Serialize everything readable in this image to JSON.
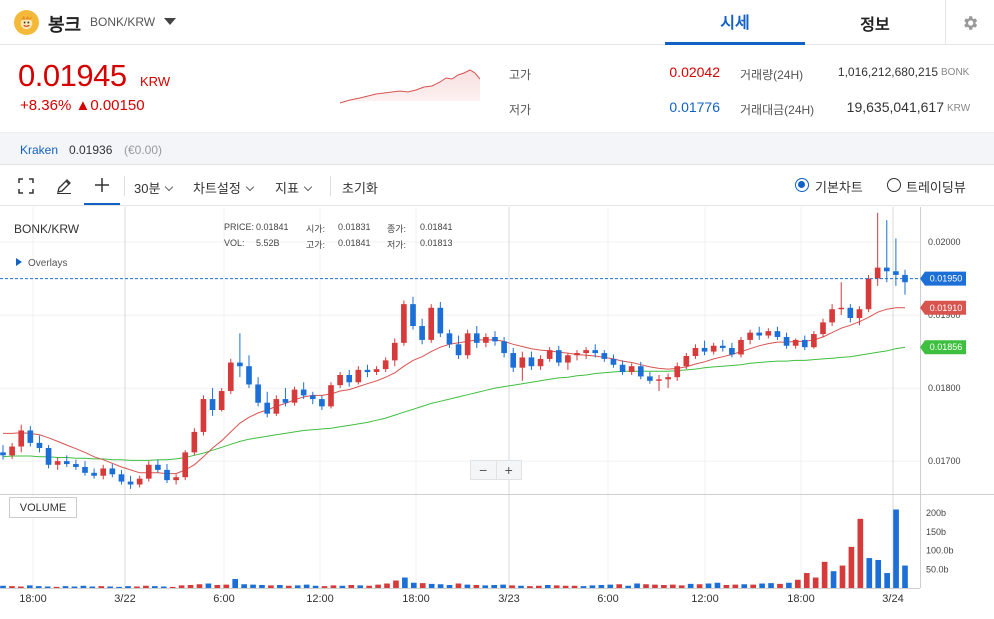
{
  "header": {
    "coin_name": "봉크",
    "pair": "BONK/KRW",
    "tabs": [
      "시세",
      "정보"
    ]
  },
  "price": {
    "current": "0.01945",
    "unit": "KRW",
    "change_pct": "+8.36%",
    "change_amt": "▲0.00150"
  },
  "stats": {
    "high_label": "고가",
    "high_value": "0.02042",
    "low_label": "저가",
    "low_value": "0.01776",
    "volume_label": "거래량(24H)",
    "volume_value": "1,016,212,680,215",
    "volume_unit": "BONK",
    "amount_label": "거래대금(24H)",
    "amount_value": "19,635,041,617",
    "amount_unit": "KRW"
  },
  "exchange": {
    "name": "Kraken",
    "price": "0.01936",
    "diff": "(€0.00)"
  },
  "toolbar": {
    "interval": "30분",
    "chart_settings": "차트설정",
    "indicators": "지표",
    "reset": "초기화",
    "basic_chart": "기본차트",
    "tradingview": "트레이딩뷰"
  },
  "chart_legend": {
    "pair": "BONK/KRW",
    "overlays": "Overlays",
    "price_label": "PRICE:",
    "price_value": "0.01841",
    "open_label": "시가:",
    "open_value": "0.01831",
    "change_label": "종가:",
    "change_value": "0.01841",
    "vol_label": "VOL:",
    "vol_value": "5.52B",
    "high_label": "고가:",
    "high_value": "0.01841",
    "low_label": "저가:",
    "low_value": "0.01813",
    "volume_pane": "VOLUME"
  },
  "colors": {
    "up": "#d63a3a",
    "down": "#1b6fd6",
    "ma_short": "#d9534f",
    "ma_long": "#3fbf3f",
    "accent": "#1261c4"
  },
  "chart_data": {
    "type": "candlestick",
    "title": "BONK/KRW",
    "price_axis_ticks": [
      "0.02000",
      "0.01900",
      "0.01800",
      "0.01700"
    ],
    "price_axis_tick_values": [
      0.02,
      0.019,
      0.018,
      0.017
    ],
    "volume_axis_ticks": [
      "200b",
      "150b",
      "100.0b",
      "50.0b"
    ],
    "volume_axis_tick_values": [
      200,
      150,
      100,
      50
    ],
    "time_axis_ticks": [
      "18:00",
      "3/22",
      "6:00",
      "12:00",
      "18:00",
      "3/23",
      "6:00",
      "12:00",
      "18:00",
      "3/24"
    ],
    "ylim": [
      0.01655,
      0.02048
    ],
    "vol_ylim": [
      0,
      230
    ],
    "current_price_label": "0.01950",
    "current_price": 0.0195,
    "ma_short_label": "0.01910",
    "ma_short_last": 0.0191,
    "ma_long_label": "0.01856",
    "ma_long_last": 0.01856,
    "candles": [
      [
        0.01712,
        0.01722,
        0.01702,
        0.01708
      ],
      [
        0.01708,
        0.01725,
        0.01703,
        0.0172
      ],
      [
        0.0172,
        0.0175,
        0.01712,
        0.01742
      ],
      [
        0.01742,
        0.01748,
        0.0172,
        0.01725
      ],
      [
        0.01725,
        0.01735,
        0.01712,
        0.01718
      ],
      [
        0.01718,
        0.01722,
        0.0169,
        0.01695
      ],
      [
        0.01695,
        0.01705,
        0.01688,
        0.017
      ],
      [
        0.017,
        0.01708,
        0.01692,
        0.01696
      ],
      [
        0.01696,
        0.01702,
        0.01688,
        0.01692
      ],
      [
        0.01692,
        0.017,
        0.0168,
        0.01684
      ],
      [
        0.01684,
        0.0169,
        0.01676,
        0.0168
      ],
      [
        0.0168,
        0.01695,
        0.01675,
        0.0169
      ],
      [
        0.0169,
        0.01696,
        0.01678,
        0.01682
      ],
      [
        0.01682,
        0.01688,
        0.01668,
        0.01672
      ],
      [
        0.01672,
        0.0168,
        0.01662,
        0.01668
      ],
      [
        0.01668,
        0.0168,
        0.01664,
        0.01676
      ],
      [
        0.01676,
        0.017,
        0.01672,
        0.01695
      ],
      [
        0.01695,
        0.01702,
        0.01684,
        0.01688
      ],
      [
        0.01688,
        0.01696,
        0.0167,
        0.01674
      ],
      [
        0.01674,
        0.01682,
        0.01668,
        0.01678
      ],
      [
        0.01678,
        0.01715,
        0.01674,
        0.01712
      ],
      [
        0.01712,
        0.01745,
        0.01708,
        0.0174
      ],
      [
        0.0174,
        0.0179,
        0.01735,
        0.01785
      ],
      [
        0.01785,
        0.018,
        0.01762,
        0.0177
      ],
      [
        0.0177,
        0.018,
        0.01768,
        0.01796
      ],
      [
        0.01796,
        0.0184,
        0.01792,
        0.01835
      ],
      [
        0.01835,
        0.01875,
        0.01815,
        0.0183
      ],
      [
        0.0183,
        0.01845,
        0.018,
        0.01805
      ],
      [
        0.01805,
        0.01815,
        0.01775,
        0.0178
      ],
      [
        0.0178,
        0.01795,
        0.0176,
        0.01765
      ],
      [
        0.01765,
        0.0179,
        0.01762,
        0.01785
      ],
      [
        0.01785,
        0.018,
        0.01775,
        0.0178
      ],
      [
        0.0178,
        0.01802,
        0.01776,
        0.01798
      ],
      [
        0.01798,
        0.01808,
        0.01785,
        0.0179
      ],
      [
        0.0179,
        0.01795,
        0.01778,
        0.01785
      ],
      [
        0.01785,
        0.0179,
        0.0177,
        0.01775
      ],
      [
        0.01775,
        0.01808,
        0.01772,
        0.01804
      ],
      [
        0.01804,
        0.01822,
        0.018,
        0.01818
      ],
      [
        0.01818,
        0.01825,
        0.01802,
        0.01808
      ],
      [
        0.01808,
        0.0183,
        0.01805,
        0.01825
      ],
      [
        0.01825,
        0.01832,
        0.01815,
        0.01822
      ],
      [
        0.01822,
        0.0183,
        0.01818,
        0.01826
      ],
      [
        0.01826,
        0.01842,
        0.01822,
        0.01838
      ],
      [
        0.01838,
        0.01868,
        0.0183,
        0.01862
      ],
      [
        0.01862,
        0.0192,
        0.01858,
        0.01915
      ],
      [
        0.01915,
        0.01925,
        0.0188,
        0.01885
      ],
      [
        0.01885,
        0.01895,
        0.0186,
        0.01866
      ],
      [
        0.01866,
        0.01915,
        0.01862,
        0.0191
      ],
      [
        0.0191,
        0.01918,
        0.0187,
        0.01875
      ],
      [
        0.01875,
        0.0188,
        0.01855,
        0.0186
      ],
      [
        0.0186,
        0.01872,
        0.0184,
        0.01845
      ],
      [
        0.01845,
        0.0188,
        0.0184,
        0.01875
      ],
      [
        0.01875,
        0.01885,
        0.01855,
        0.01862
      ],
      [
        0.01862,
        0.01875,
        0.01856,
        0.0187
      ],
      [
        0.0187,
        0.01878,
        0.01858,
        0.01864
      ],
      [
        0.01864,
        0.0187,
        0.01842,
        0.01848
      ],
      [
        0.01848,
        0.01855,
        0.01822,
        0.01828
      ],
      [
        0.01828,
        0.0185,
        0.0181,
        0.01842
      ],
      [
        0.01842,
        0.0185,
        0.01825,
        0.0183
      ],
      [
        0.0183,
        0.01845,
        0.01825,
        0.0184
      ],
      [
        0.0184,
        0.01856,
        0.01836,
        0.01852
      ],
      [
        0.01852,
        0.01858,
        0.0183,
        0.01835
      ],
      [
        0.01835,
        0.01848,
        0.01825,
        0.01845
      ],
      [
        0.01845,
        0.01852,
        0.01838,
        0.01848
      ],
      [
        0.01848,
        0.01856,
        0.0184,
        0.01852
      ],
      [
        0.01852,
        0.0186,
        0.01842,
        0.01848
      ],
      [
        0.01848,
        0.01852,
        0.01836,
        0.0184
      ],
      [
        0.0184,
        0.01846,
        0.01828,
        0.01832
      ],
      [
        0.01832,
        0.01838,
        0.01818,
        0.01822
      ],
      [
        0.01822,
        0.01834,
        0.01818,
        0.0183
      ],
      [
        0.0183,
        0.01836,
        0.01812,
        0.01816
      ],
      [
        0.01816,
        0.01822,
        0.01806,
        0.0181
      ],
      [
        0.0181,
        0.01818,
        0.01796,
        0.01812
      ],
      [
        0.01812,
        0.0182,
        0.018,
        0.01815
      ],
      [
        0.01815,
        0.01835,
        0.0181,
        0.0183
      ],
      [
        0.0183,
        0.01848,
        0.01826,
        0.01844
      ],
      [
        0.01844,
        0.0186,
        0.0184,
        0.01855
      ],
      [
        0.01855,
        0.01865,
        0.01845,
        0.0185
      ],
      [
        0.0185,
        0.01862,
        0.01846,
        0.01858
      ],
      [
        0.01858,
        0.01866,
        0.0185,
        0.01855
      ],
      [
        0.01855,
        0.01862,
        0.01842,
        0.01846
      ],
      [
        0.01846,
        0.0187,
        0.01842,
        0.01866
      ],
      [
        0.01866,
        0.0188,
        0.0186,
        0.01876
      ],
      [
        0.01876,
        0.01884,
        0.01866,
        0.01872
      ],
      [
        0.01872,
        0.01882,
        0.01868,
        0.01878
      ],
      [
        0.01878,
        0.01884,
        0.01866,
        0.0187
      ],
      [
        0.0187,
        0.01876,
        0.01854,
        0.01858
      ],
      [
        0.01858,
        0.01868,
        0.01854,
        0.01866
      ],
      [
        0.01866,
        0.01872,
        0.01852,
        0.01856
      ],
      [
        0.01856,
        0.01878,
        0.01854,
        0.01874
      ],
      [
        0.01874,
        0.01895,
        0.0187,
        0.0189
      ],
      [
        0.0189,
        0.01915,
        0.01885,
        0.01908
      ],
      [
        0.01908,
        0.01945,
        0.019,
        0.0191
      ],
      [
        0.0191,
        0.01915,
        0.0189,
        0.01896
      ],
      [
        0.01896,
        0.01912,
        0.01886,
        0.01908
      ],
      [
        0.01908,
        0.01955,
        0.01904,
        0.0195
      ],
      [
        0.0195,
        0.0204,
        0.0194,
        0.01965
      ],
      [
        0.01965,
        0.0203,
        0.01945,
        0.0196
      ],
      [
        0.0196,
        0.02005,
        0.0194,
        0.01955
      ],
      [
        0.01955,
        0.01962,
        0.01928,
        0.01945
      ]
    ],
    "volumes": [
      6,
      5,
      4,
      7,
      5,
      4,
      3,
      5,
      4,
      6,
      4,
      5,
      4,
      3,
      5,
      4,
      6,
      5,
      4,
      3,
      7,
      8,
      10,
      12,
      8,
      9,
      24,
      10,
      9,
      8,
      7,
      8,
      6,
      7,
      9,
      6,
      5,
      7,
      6,
      8,
      7,
      6,
      9,
      12,
      20,
      28,
      14,
      13,
      11,
      10,
      8,
      12,
      9,
      8,
      7,
      8,
      9,
      7,
      6,
      5,
      6,
      8,
      7,
      6,
      6,
      5,
      7,
      8,
      9,
      10,
      6,
      12,
      10,
      9,
      8,
      9,
      7,
      11,
      10,
      12,
      14,
      8,
      9,
      10,
      9,
      12,
      13,
      11,
      14,
      22,
      40,
      28,
      70,
      45,
      60,
      110,
      185,
      80,
      75,
      40,
      210,
      60
    ],
    "ma_short": [
      0.01738,
      0.01738,
      0.01739,
      0.01738,
      0.01736,
      0.01732,
      0.01727,
      0.01722,
      0.01717,
      0.01712,
      0.01706,
      0.01702,
      0.01697,
      0.01692,
      0.01688,
      0.01684,
      0.01684,
      0.01684,
      0.01683,
      0.01683,
      0.01688,
      0.01695,
      0.01706,
      0.01718,
      0.01728,
      0.0174,
      0.01752,
      0.0176,
      0.01766,
      0.0177,
      0.01775,
      0.01779,
      0.01784,
      0.01788,
      0.0179,
      0.0179,
      0.01792,
      0.01796,
      0.01798,
      0.01802,
      0.01806,
      0.0181,
      0.01815,
      0.01821,
      0.0183,
      0.01838,
      0.01843,
      0.0185,
      0.01856,
      0.0186,
      0.01862,
      0.01864,
      0.01866,
      0.01866,
      0.01866,
      0.01864,
      0.0186,
      0.01857,
      0.01854,
      0.01852,
      0.01851,
      0.01849,
      0.01848,
      0.01846,
      0.01845,
      0.01844,
      0.01842,
      0.0184,
      0.01837,
      0.01835,
      0.01832,
      0.01829,
      0.01827,
      0.01826,
      0.01827,
      0.01829,
      0.01833,
      0.01836,
      0.0184,
      0.01843,
      0.01846,
      0.0185,
      0.01854,
      0.01858,
      0.01861,
      0.01863,
      0.01863,
      0.01864,
      0.01864,
      0.01866,
      0.0187,
      0.01876,
      0.01882,
      0.01886,
      0.01891,
      0.01897,
      0.01904,
      0.01908,
      0.0191,
      0.0191
    ],
    "ma_long": [
      0.01706,
      0.01707,
      0.01707,
      0.01707,
      0.01706,
      0.01706,
      0.01705,
      0.01705,
      0.01704,
      0.01704,
      0.01703,
      0.01703,
      0.01702,
      0.01702,
      0.01701,
      0.01701,
      0.01701,
      0.01702,
      0.01702,
      0.01703,
      0.01705,
      0.01708,
      0.01711,
      0.01715,
      0.01719,
      0.01723,
      0.01727,
      0.0173,
      0.01732,
      0.01734,
      0.01736,
      0.01738,
      0.0174,
      0.01742,
      0.01743,
      0.01744,
      0.01745,
      0.01747,
      0.01749,
      0.01751,
      0.01753,
      0.01756,
      0.01759,
      0.01763,
      0.01767,
      0.01771,
      0.01775,
      0.01779,
      0.01782,
      0.01785,
      0.01788,
      0.01791,
      0.01794,
      0.01797,
      0.018,
      0.01802,
      0.01804,
      0.01806,
      0.01808,
      0.0181,
      0.01812,
      0.01814,
      0.01815,
      0.01817,
      0.01818,
      0.0182,
      0.01821,
      0.01822,
      0.01823,
      0.01823,
      0.01823,
      0.01823,
      0.01823,
      0.01823,
      0.01824,
      0.01825,
      0.01826,
      0.01828,
      0.01829,
      0.0183,
      0.01831,
      0.01832,
      0.01834,
      0.01835,
      0.01836,
      0.01837,
      0.01837,
      0.01838,
      0.01838,
      0.01839,
      0.0184,
      0.01841,
      0.01842,
      0.01843,
      0.01845,
      0.01847,
      0.01849,
      0.01851,
      0.01854,
      0.01856
    ]
  }
}
